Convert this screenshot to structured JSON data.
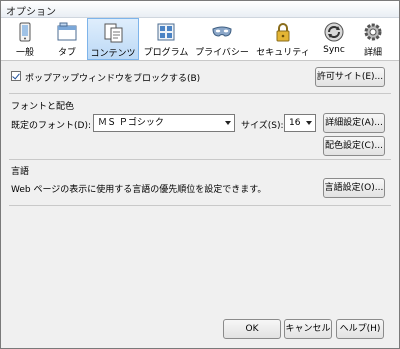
{
  "window": {
    "title": "オプション"
  },
  "tabs": [
    {
      "label": "一般",
      "icon": "general-device-icon"
    },
    {
      "label": "タブ",
      "icon": "tabs-window-icon"
    },
    {
      "label": "コンテンツ",
      "icon": "content-page-icon",
      "selected": true
    },
    {
      "label": "プログラム",
      "icon": "applications-grid-icon"
    },
    {
      "label": "プライバシー",
      "icon": "privacy-mask-icon"
    },
    {
      "label": "セキュリティ",
      "icon": "security-lock-icon"
    },
    {
      "label": "Sync",
      "icon": "sync-arrows-icon"
    },
    {
      "label": "詳細",
      "icon": "advanced-gear-icon"
    }
  ],
  "popup": {
    "checkbox_label": "ポップアップウィンドウをブロックする(B)",
    "checked": true,
    "exceptions_button": "許可サイト(E)..."
  },
  "fonts": {
    "section_title": "フォントと配色",
    "default_font_label": "既定のフォント(D):",
    "default_font_value": "ＭＳ Ｐゴシック",
    "size_label": "サイズ(S):",
    "size_value": "16",
    "advanced_button": "詳細設定(A)...",
    "colors_button": "配色設定(C)..."
  },
  "language": {
    "section_title": "言語",
    "description": "Web ページの表示に使用する言語の優先順位を設定できます。",
    "choose_button": "言語設定(O)..."
  },
  "footer": {
    "ok": "OK",
    "cancel": "キャンセル",
    "help": "ヘルプ(H)"
  },
  "colors": {
    "selected_tab_border": "#7eb4ea",
    "selected_tab_bg": "#cfe5fb"
  }
}
